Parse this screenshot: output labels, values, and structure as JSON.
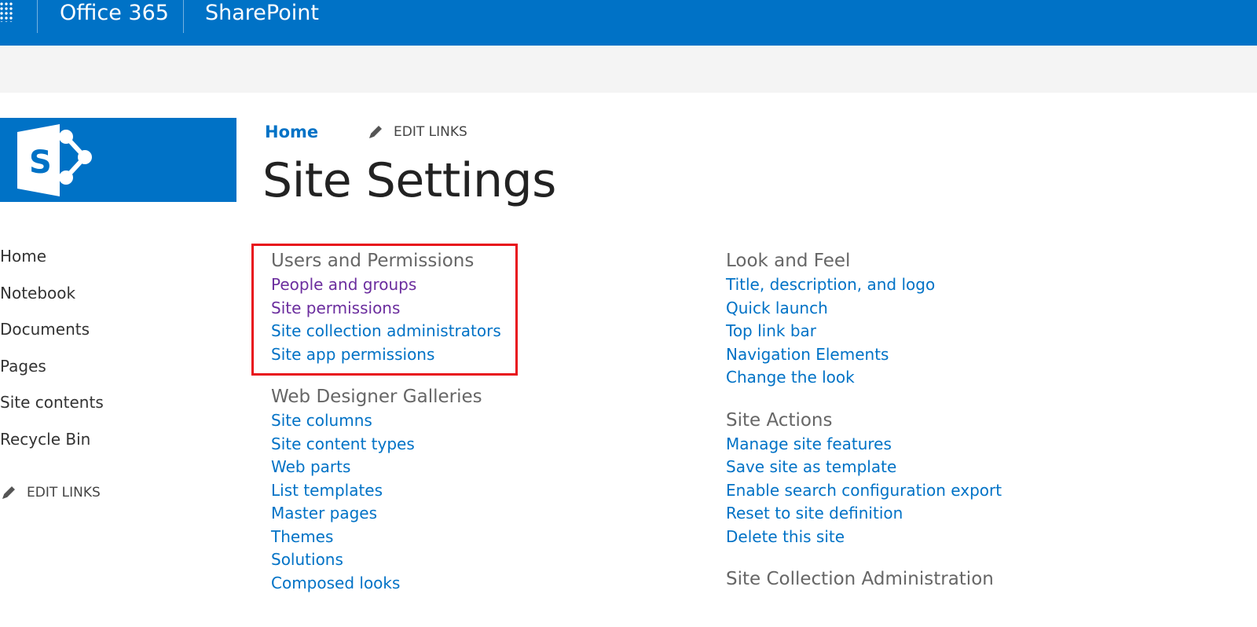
{
  "suite_bar": {
    "office_label": "Office 365",
    "product_label": "SharePoint"
  },
  "breadcrumb": {
    "home_label": "Home",
    "edit_links_label": "EDIT LINKS"
  },
  "page_title": "Site Settings",
  "left_nav": {
    "items": [
      {
        "label": "Home"
      },
      {
        "label": "Notebook"
      },
      {
        "label": "Documents"
      },
      {
        "label": "Pages"
      },
      {
        "label": "Site contents"
      },
      {
        "label": "Recycle Bin"
      }
    ],
    "edit_links_label": "EDIT LINKS"
  },
  "column1": {
    "groups": [
      {
        "title": "Users and Permissions",
        "links": [
          {
            "label": "People and groups",
            "visited": true
          },
          {
            "label": "Site permissions",
            "visited": true
          },
          {
            "label": "Site collection administrators",
            "visited": false
          },
          {
            "label": "Site app permissions",
            "visited": false
          }
        ]
      },
      {
        "title": "Web Designer Galleries",
        "links": [
          {
            "label": "Site columns"
          },
          {
            "label": "Site content types"
          },
          {
            "label": "Web parts"
          },
          {
            "label": "List templates"
          },
          {
            "label": "Master pages"
          },
          {
            "label": "Themes"
          },
          {
            "label": "Solutions"
          },
          {
            "label": "Composed looks"
          }
        ]
      }
    ]
  },
  "column2": {
    "groups": [
      {
        "title": "Look and Feel",
        "links": [
          {
            "label": "Title, description, and logo"
          },
          {
            "label": "Quick launch"
          },
          {
            "label": "Top link bar"
          },
          {
            "label": "Navigation Elements"
          },
          {
            "label": "Change the look"
          }
        ]
      },
      {
        "title": "Site Actions",
        "links": [
          {
            "label": "Manage site features"
          },
          {
            "label": "Save site as template"
          },
          {
            "label": "Enable search configuration export"
          },
          {
            "label": "Reset to site definition"
          },
          {
            "label": "Delete this site"
          }
        ]
      },
      {
        "title": "Site Collection Administration",
        "links": []
      }
    ]
  },
  "colors": {
    "brand_blue": "#0072c6",
    "visited_link": "#6b2d9e",
    "highlight_red": "#e8101a"
  }
}
